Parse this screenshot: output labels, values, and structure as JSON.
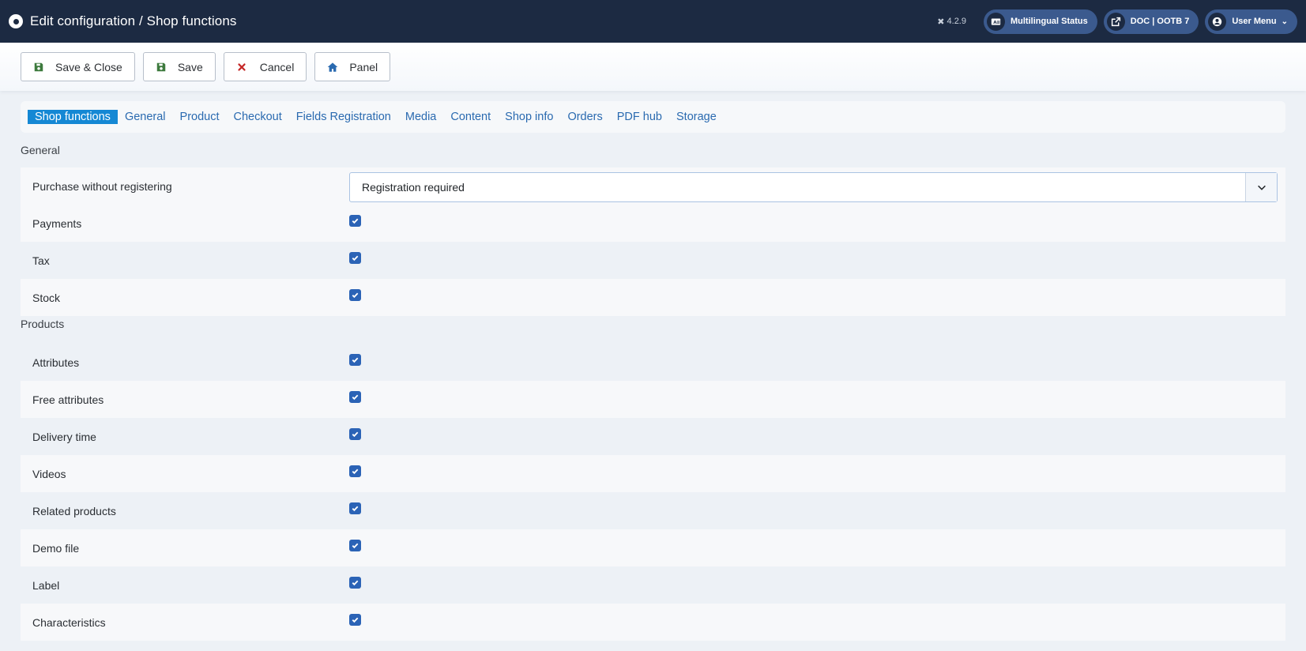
{
  "header": {
    "title": "Edit configuration / Shop functions",
    "version": "4.2.9",
    "multilingual_label": "Multilingual Status",
    "doc_label": "DOC | OOTB 7",
    "user_menu_label": "User Menu"
  },
  "toolbar": {
    "save_close_label": "Save & Close",
    "save_label": "Save",
    "cancel_label": "Cancel",
    "panel_label": "Panel"
  },
  "tabs": [
    {
      "label": "Shop functions",
      "active": true
    },
    {
      "label": "General"
    },
    {
      "label": "Product"
    },
    {
      "label": "Checkout"
    },
    {
      "label": "Fields Registration"
    },
    {
      "label": "Media"
    },
    {
      "label": "Content"
    },
    {
      "label": "Shop info"
    },
    {
      "label": "Orders"
    },
    {
      "label": "PDF hub"
    },
    {
      "label": "Storage"
    }
  ],
  "general": {
    "title": "General",
    "purchase_label": "Purchase without registering",
    "purchase_value": "Registration required",
    "payments_label": "Payments",
    "tax_label": "Tax",
    "stock_label": "Stock"
  },
  "products": {
    "title": "Products",
    "items": [
      {
        "label": "Attributes",
        "checked": true
      },
      {
        "label": "Free attributes",
        "checked": true
      },
      {
        "label": "Delivery time",
        "checked": true
      },
      {
        "label": "Videos",
        "checked": true
      },
      {
        "label": "Related products",
        "checked": true
      },
      {
        "label": "Demo file",
        "checked": true
      },
      {
        "label": "Label",
        "checked": true
      },
      {
        "label": "Characteristics",
        "checked": true
      }
    ]
  },
  "colors": {
    "header_bg": "#1c2a42",
    "accent": "#1588d4",
    "checkbox": "#2b63b6",
    "link": "#2a6ab0"
  }
}
